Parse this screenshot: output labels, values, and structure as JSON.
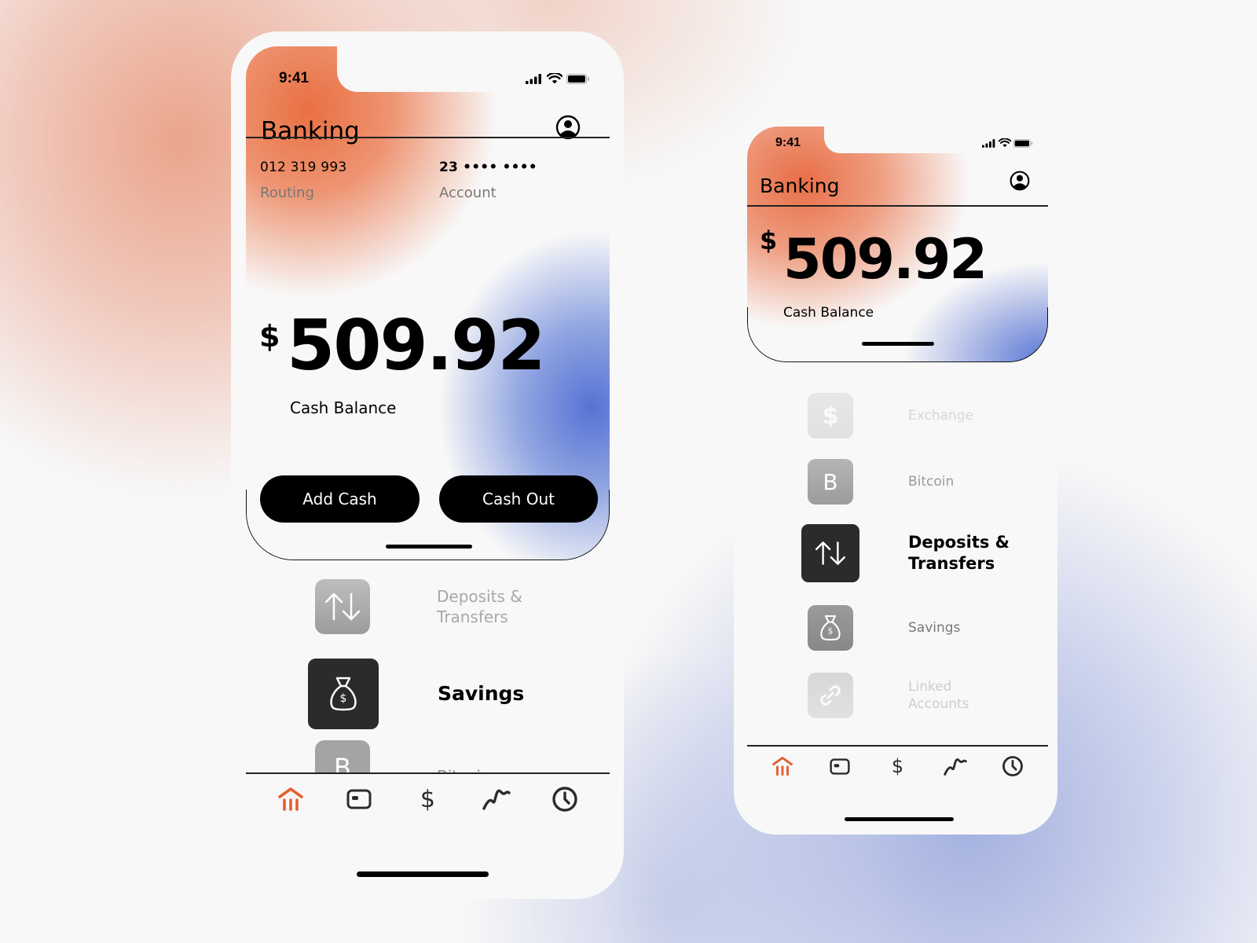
{
  "colors": {
    "accent_orange": "#e4602e",
    "gradient_orange": "#e97042",
    "gradient_blue": "#5673d4",
    "text_primary": "#000000",
    "text_secondary": "#777777",
    "icon_gray": "#9b9b9b",
    "icon_active": "#2b2b2b"
  },
  "phone_large": {
    "status_bar": {
      "time": "9:41",
      "icons": [
        "signal-icon",
        "wifi-icon",
        "battery-icon"
      ]
    },
    "header": {
      "title": "Banking",
      "profile_icon": "profile-icon"
    },
    "account": {
      "routing_number": "012 319 993",
      "routing_label": "Routing",
      "account_number": "23 •••• ••••",
      "account_label": "Account"
    },
    "balance": {
      "currency": "$",
      "amount": "509.92",
      "label": "Cash Balance"
    },
    "actions": {
      "add_cash": "Add Cash",
      "cash_out": "Cash Out"
    },
    "menu": [
      {
        "label_line1": "Deposits &",
        "label_line2": "Transfers",
        "icon": "transfer-arrows-icon",
        "state": "faded"
      },
      {
        "label_line1": "Savings",
        "label_line2": "",
        "icon": "money-bag-icon",
        "state": "selected"
      },
      {
        "label_line1": "Bitcoin",
        "label_line2": "",
        "icon": "bitcoin-icon",
        "state": "faded"
      }
    ],
    "tabs": [
      {
        "name": "home",
        "icon": "bank-icon",
        "active": true
      },
      {
        "name": "cards",
        "icon": "card-icon",
        "active": false
      },
      {
        "name": "payments",
        "icon": "dollar-icon",
        "active": false
      },
      {
        "name": "investing",
        "icon": "chart-squiggle-icon",
        "active": false
      },
      {
        "name": "activity",
        "icon": "clock-icon",
        "active": false
      }
    ]
  },
  "phone_small": {
    "status_bar": {
      "time": "9:41",
      "icons": [
        "signal-icon",
        "wifi-icon",
        "battery-icon"
      ]
    },
    "header": {
      "title": "Banking",
      "profile_icon": "profile-icon"
    },
    "balance": {
      "currency": "$",
      "amount": "509.92",
      "label": "Cash Balance"
    },
    "menu": [
      {
        "label_line1": "Exchange",
        "label_line2": "",
        "icon": "dollar-icon",
        "state": "very-faded"
      },
      {
        "label_line1": "Bitcoin",
        "label_line2": "",
        "icon": "bitcoin-icon",
        "state": "faded"
      },
      {
        "label_line1": "Deposits &",
        "label_line2": "Transfers",
        "icon": "transfer-arrows-icon",
        "state": "selected"
      },
      {
        "label_line1": "Savings",
        "label_line2": "",
        "icon": "money-bag-icon",
        "state": "faded"
      },
      {
        "label_line1": "Linked",
        "label_line2": "Accounts",
        "icon": "link-icon",
        "state": "very-faded"
      }
    ],
    "tabs": [
      {
        "name": "home",
        "icon": "bank-icon",
        "active": true
      },
      {
        "name": "cards",
        "icon": "card-icon",
        "active": false
      },
      {
        "name": "payments",
        "icon": "dollar-icon",
        "active": false
      },
      {
        "name": "investing",
        "icon": "chart-squiggle-icon",
        "active": false
      },
      {
        "name": "activity",
        "icon": "clock-icon",
        "active": false
      }
    ]
  }
}
